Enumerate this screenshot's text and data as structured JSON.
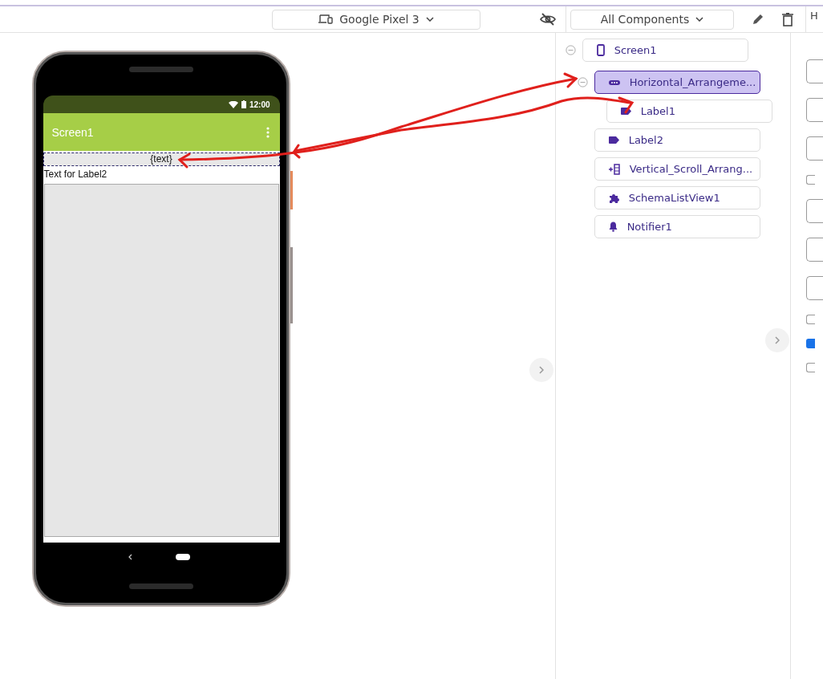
{
  "toolbar": {
    "device": "Google Pixel 3",
    "components_filter": "All Components",
    "properties_header": "H"
  },
  "phone": {
    "time": "12:00",
    "title": "Screen1",
    "components": [
      {
        "kind": "horizontal_arrangement",
        "selected": true,
        "children": [
          {
            "kind": "label",
            "text": "{text}",
            "selected": false
          }
        ]
      },
      {
        "kind": "label",
        "text": "Text for Label2",
        "selected": false
      },
      {
        "kind": "vertical_scroll",
        "selected": false
      }
    ]
  },
  "tree": [
    {
      "name": "Screen1",
      "kind": "screen",
      "selected": false,
      "expanded": true,
      "children": [
        {
          "name": "Horizontal_Arrangeme...",
          "kind": "arrangement",
          "selected": true,
          "expanded": true,
          "children": [
            {
              "name": "Label1",
              "kind": "label",
              "selected": false
            }
          ]
        },
        {
          "name": "Label2",
          "kind": "label",
          "selected": false
        },
        {
          "name": "Vertical_Scroll_Arrang...",
          "kind": "scroll",
          "selected": false
        },
        {
          "name": "SchemaListView1",
          "kind": "extension",
          "selected": false
        },
        {
          "name": "Notifier1",
          "kind": "notifier",
          "selected": false
        }
      ]
    }
  ],
  "properties": [
    {
      "kind": "field"
    },
    {
      "kind": "field"
    },
    {
      "kind": "field"
    },
    {
      "kind": "checkbox",
      "checked": false
    },
    {
      "kind": "field"
    },
    {
      "kind": "field"
    },
    {
      "kind": "field"
    },
    {
      "kind": "checkbox",
      "checked": false
    },
    {
      "kind": "checkbox",
      "checked": true
    },
    {
      "kind": "checkbox",
      "checked": false
    }
  ]
}
